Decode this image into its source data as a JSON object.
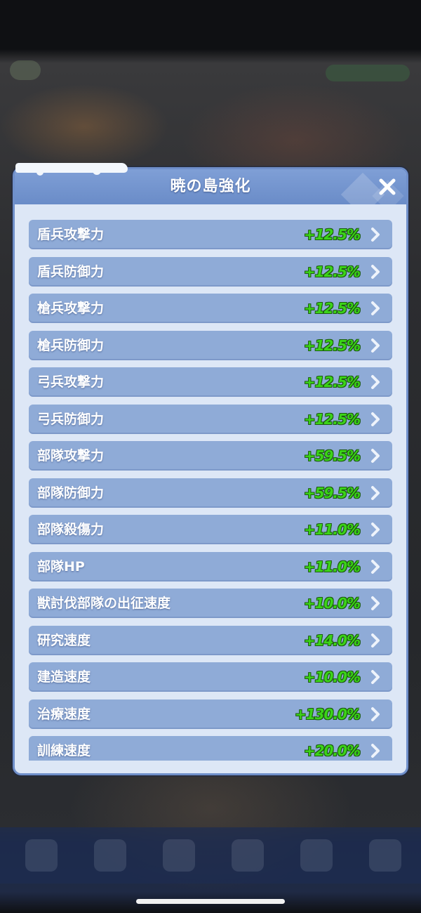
{
  "panel": {
    "title": "暁の島強化",
    "close_icon": "close-icon",
    "rows": [
      {
        "label": "盾兵攻撃力",
        "value": "+12.5%"
      },
      {
        "label": "盾兵防御力",
        "value": "+12.5%"
      },
      {
        "label": "槍兵攻撃力",
        "value": "+12.5%"
      },
      {
        "label": "槍兵防御力",
        "value": "+12.5%"
      },
      {
        "label": "弓兵攻撃力",
        "value": "+12.5%"
      },
      {
        "label": "弓兵防御力",
        "value": "+12.5%"
      },
      {
        "label": "部隊攻撃力",
        "value": "+59.5%"
      },
      {
        "label": "部隊防御力",
        "value": "+59.5%"
      },
      {
        "label": "部隊殺傷力",
        "value": "+11.0%"
      },
      {
        "label": "部隊HP",
        "value": "+11.0%"
      },
      {
        "label": "獣討伐部隊の出征速度",
        "value": "+10.0%"
      },
      {
        "label": "研究速度",
        "value": "+14.0%"
      },
      {
        "label": "建造速度",
        "value": "+10.0%"
      },
      {
        "label": "治療速度",
        "value": "+130.0%"
      },
      {
        "label": "訓練速度",
        "value": "+20.0%"
      }
    ]
  },
  "colors": {
    "header": "#6a8cc8",
    "row_bg": "#8fabd7",
    "panel_bg": "#dde7f6",
    "value_green": "#3bd418"
  },
  "icons": {
    "row_chevron": "chevron-right-icon"
  }
}
